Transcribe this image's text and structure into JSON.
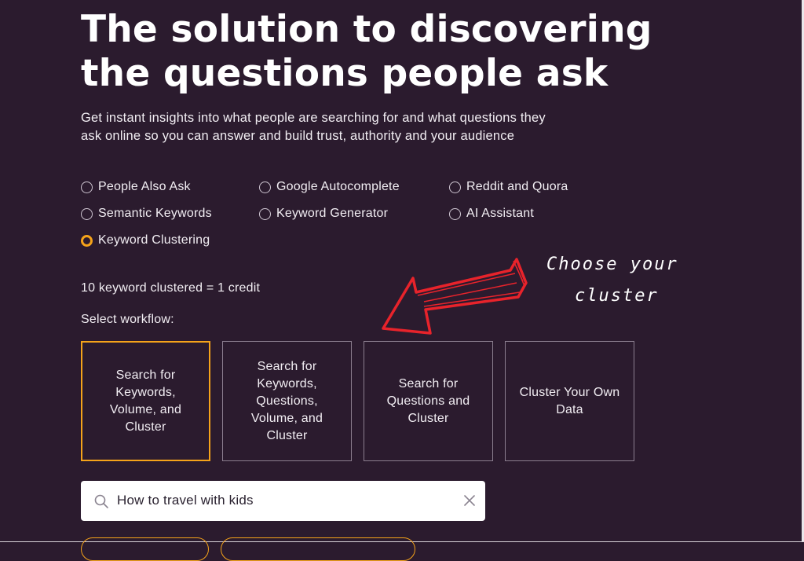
{
  "hero": {
    "title_line1": "The solution to discovering",
    "title_line2": "the questions people ask",
    "subtitle_line1": "Get instant insights into what people are searching for and what questions they",
    "subtitle_line2": "ask online so you can answer and build trust, authority and your audience"
  },
  "tools": [
    {
      "label": "People Also Ask",
      "selected": false
    },
    {
      "label": "Google Autocomplete",
      "selected": false
    },
    {
      "label": "Reddit and Quora",
      "selected": false
    },
    {
      "label": "Semantic Keywords",
      "selected": false
    },
    {
      "label": "Keyword Generator",
      "selected": false
    },
    {
      "label": "AI Assistant",
      "selected": false
    },
    {
      "label": "Keyword Clustering",
      "selected": true
    }
  ],
  "credit_note": "10 keyword clustered = 1 credit",
  "workflow": {
    "label": "Select workflow:",
    "cards": [
      {
        "label": "Search for Keywords, Volume, and Cluster",
        "selected": true
      },
      {
        "label": "Search for Keywords, Questions, Volume, and Cluster",
        "selected": false
      },
      {
        "label": "Search for Questions and Cluster",
        "selected": false
      },
      {
        "label": "Cluster Your Own Data",
        "selected": false
      }
    ]
  },
  "search": {
    "value": "How to travel with kids",
    "icon": "search-icon",
    "clear_icon": "close-icon"
  },
  "annotation": {
    "line1": "Choose your",
    "line2": "cluster",
    "arrow_color": "#e8232b"
  },
  "colors": {
    "background": "#2b1b2e",
    "accent": "#f5a31a",
    "text": "#ffffff"
  }
}
